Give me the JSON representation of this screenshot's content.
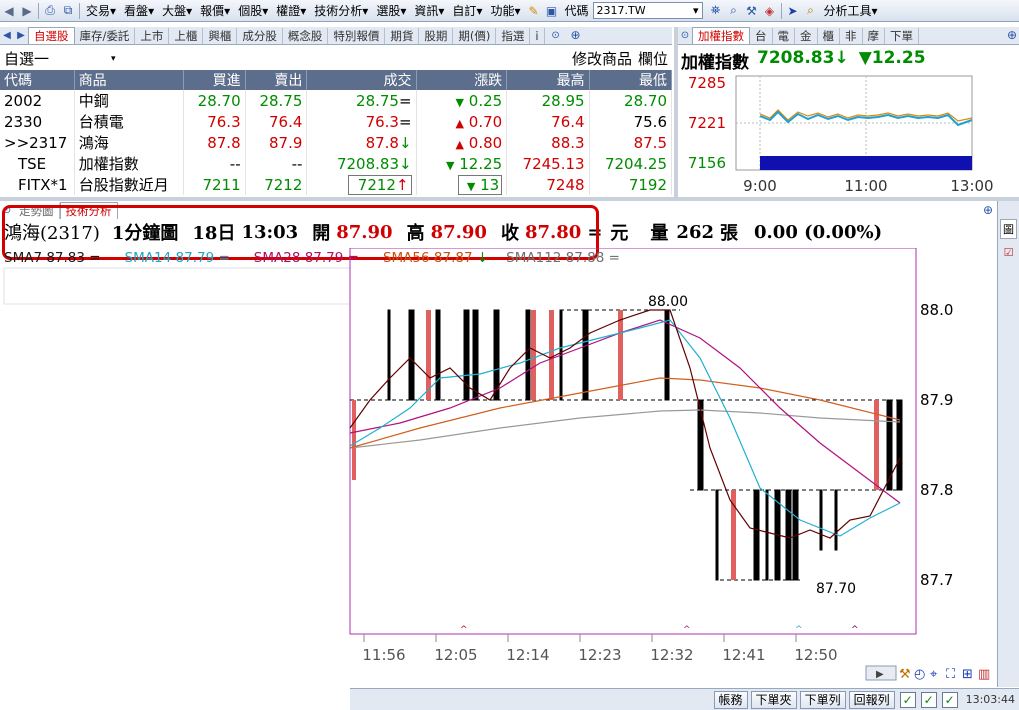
{
  "toolbar": {
    "nav_back": "◂",
    "nav_fwd": "▸",
    "menus": [
      "交易",
      "看盤",
      "大盤",
      "報價",
      "個股",
      "權證",
      "技術分析",
      "選股",
      "資訊",
      "自訂",
      "功能"
    ],
    "code_label": "代碼",
    "code_value": "2317.TW",
    "analysis_tool": "分析工具"
  },
  "watchlist": {
    "tabs": [
      "自選股",
      "庫存/委託",
      "上市",
      "上櫃",
      "興櫃",
      "成分股",
      "概念股",
      "特別報價",
      "期貨",
      "股期",
      "期(價)",
      "指選",
      "i"
    ],
    "list_name": "自選一",
    "modify_label": "修改商品",
    "field_label": "欄位",
    "headers": [
      "代碼",
      "商品",
      "買進",
      "賣出",
      "成交",
      "漲跌",
      "最高",
      "最低"
    ],
    "rows": [
      {
        "code": "2002",
        "name": "中鋼",
        "bid": "28.70",
        "ask": "28.75",
        "last": "28.75",
        "mark": "=",
        "chg_arrow": "▼",
        "chg": "0.25",
        "high": "28.95",
        "low": "28.70",
        "color": "grn"
      },
      {
        "code": "2330",
        "name": "台積電",
        "bid": "76.3",
        "ask": "76.4",
        "last": "76.3",
        "mark": "=",
        "chg_arrow": "▲",
        "chg": "0.70",
        "high": "76.4",
        "low": "75.6",
        "color": "red"
      },
      {
        "code": ">>2317",
        "name": "鴻海",
        "bid": "87.8",
        "ask": "87.9",
        "last": "87.8",
        "mark": "↓",
        "chg_arrow": "▲",
        "chg": "0.80",
        "high": "88.3",
        "low": "87.5",
        "color": "red"
      },
      {
        "code": "TSE",
        "name": "加權指數",
        "bid": "--",
        "ask": "--",
        "last": "7208.83",
        "mark": "↓",
        "chg_arrow": "▼",
        "chg": "12.25",
        "high": "7245.13",
        "low": "7204.25",
        "color": "grn"
      },
      {
        "code": "FITX*1",
        "name": "台股指數近月",
        "bid": "7211",
        "ask": "7212",
        "last": "7212",
        "mark": "↑",
        "chg_arrow": "▼",
        "chg": "13",
        "high": "7248",
        "low": "7192",
        "color": "grn"
      }
    ]
  },
  "index_panel": {
    "tabs": [
      "加權指數",
      "台",
      "電",
      "金",
      "櫃",
      "非",
      "摩",
      "下單"
    ],
    "title": "加權指數",
    "value": "7208.83",
    "arrow": "↓",
    "change_arrow": "▼",
    "change": "12.25",
    "y_labels": [
      "7285",
      "7221",
      "7156"
    ],
    "x_labels": [
      "9:00",
      "11:00",
      "13:00"
    ]
  },
  "chart": {
    "tabs": [
      "走勢圖",
      "技術分析"
    ],
    "title": {
      "name": "鴻海(2317)",
      "period": "1分鐘圖",
      "day": "18日",
      "time": "13:03",
      "open_label": "開",
      "open": "87.90",
      "high_label": "高",
      "high": "87.90",
      "close_label": "收",
      "close": "87.80",
      "eq": "=",
      "unit": "元",
      "vol_label": "量",
      "vol": "262",
      "vol_unit": "張",
      "change": "0.00 (0.00%)"
    },
    "sma": [
      {
        "label": "SMA7 87.83",
        "mark": "=",
        "color": "#1a1a1a"
      },
      {
        "label": "SMA14 87.79",
        "mark": "=",
        "color": "#1aa8c8"
      },
      {
        "label": "SMA28 87.79",
        "mark": "=",
        "color": "#b01060"
      },
      {
        "label": "SMA56 87.87",
        "mark": "↓",
        "color": "#c85010"
      },
      {
        "label": "SMA112 87.88",
        "mark": "=",
        "color": "#707070"
      }
    ],
    "y_labels": [
      "88.0",
      "87.9",
      "87.8",
      "87.7"
    ],
    "x_labels": [
      "11:56",
      "12:05",
      "12:14",
      "12:23",
      "12:32",
      "12:41",
      "12:50"
    ],
    "max_label": "88.00",
    "min_label": "87.70",
    "side_tab": "圖"
  },
  "status": {
    "buttons": [
      "帳務",
      "下單夾",
      "下單列",
      "回報列"
    ],
    "time": "13:03:44"
  }
}
